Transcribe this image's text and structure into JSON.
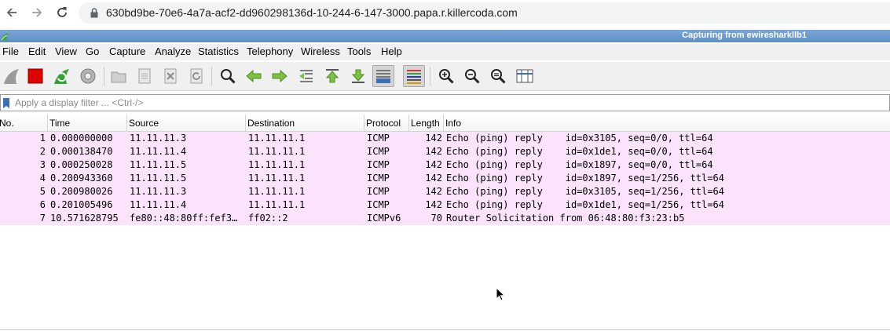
{
  "browser": {
    "url": "630bd9be-70e6-4a7a-acf2-dd960298136d-10-244-6-147-3000.papa.r.killercoda.com",
    "back_icon": "arrow-left-icon",
    "forward_icon": "arrow-right-icon",
    "reload_icon": "reload-icon",
    "lock_icon": "lock-icon"
  },
  "window": {
    "title": "Capturing from ewiresharkllb1"
  },
  "menu": [
    {
      "label": "File"
    },
    {
      "label": "Edit"
    },
    {
      "label": "View"
    },
    {
      "label": "Go"
    },
    {
      "label": "Capture"
    },
    {
      "label": "Analyze"
    },
    {
      "label": "Statistics"
    },
    {
      "label": "Telephony"
    },
    {
      "label": "Wireless"
    },
    {
      "label": "Tools"
    },
    {
      "label": "Help"
    }
  ],
  "toolbar": {
    "icons": [
      "shark-fin-start-icon",
      "stop-capture-icon",
      "restart-capture-icon",
      "capture-options-icon",
      "open-file-icon",
      "save-file-icon",
      "close-file-icon",
      "reload-file-icon",
      "find-packet-icon",
      "go-back-icon",
      "go-forward-icon",
      "go-to-packet-icon",
      "go-first-icon",
      "go-last-icon",
      "autoscroll-icon",
      "colorize-icon",
      "zoom-in-icon",
      "zoom-out-icon",
      "zoom-normal-icon",
      "resize-columns-icon"
    ]
  },
  "filter": {
    "placeholder": "Apply a display filter ... <Ctrl-/>",
    "value": ""
  },
  "packet_list": {
    "columns": [
      "No.",
      "Time",
      "Source",
      "Destination",
      "Protocol",
      "Length",
      "Info"
    ],
    "rows": [
      {
        "no": "1",
        "time": "0.000000000",
        "source": "11.11.11.3",
        "destination": "11.11.11.1",
        "protocol": "ICMP",
        "length": "142",
        "info": "Echo (ping) reply    id=0x3105, seq=0/0, ttl=64"
      },
      {
        "no": "2",
        "time": "0.000138470",
        "source": "11.11.11.4",
        "destination": "11.11.11.1",
        "protocol": "ICMP",
        "length": "142",
        "info": "Echo (ping) reply    id=0x1de1, seq=0/0, ttl=64"
      },
      {
        "no": "3",
        "time": "0.000250028",
        "source": "11.11.11.5",
        "destination": "11.11.11.1",
        "protocol": "ICMP",
        "length": "142",
        "info": "Echo (ping) reply    id=0x1897, seq=0/0, ttl=64"
      },
      {
        "no": "4",
        "time": "0.200943360",
        "source": "11.11.11.5",
        "destination": "11.11.11.1",
        "protocol": "ICMP",
        "length": "142",
        "info": "Echo (ping) reply    id=0x1897, seq=1/256, ttl=64"
      },
      {
        "no": "5",
        "time": "0.200980026",
        "source": "11.11.11.3",
        "destination": "11.11.11.1",
        "protocol": "ICMP",
        "length": "142",
        "info": "Echo (ping) reply    id=0x3105, seq=1/256, ttl=64"
      },
      {
        "no": "6",
        "time": "0.201005496",
        "source": "11.11.11.4",
        "destination": "11.11.11.1",
        "protocol": "ICMP",
        "length": "142",
        "info": "Echo (ping) reply    id=0x1de1, seq=1/256, ttl=64"
      },
      {
        "no": "7",
        "time": "10.571628795",
        "source": "fe80::48:80ff:fef3…",
        "destination": "ff02::2",
        "protocol": "ICMPv6",
        "length": "70",
        "info": "Router Solicitation from 06:48:80:f3:23:b5"
      }
    ]
  },
  "colors": {
    "row_bg": "#fbe4fb",
    "title_bar": "#6a99cf",
    "toolbar_bg": "#f0f0f0"
  }
}
